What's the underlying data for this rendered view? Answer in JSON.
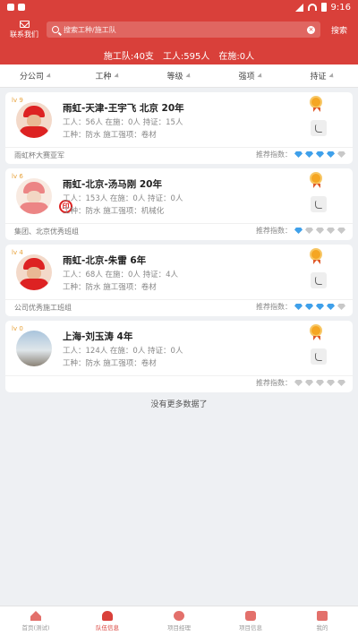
{
  "status": {
    "time": "9:16"
  },
  "header": {
    "contact_label": "联系我们",
    "search_placeholder": "搜索工种/施工队",
    "search_button": "搜索"
  },
  "summary": {
    "teams": "施工队:40支",
    "workers": "工人:595人",
    "on_site": "在施:0人"
  },
  "filters": [
    "分公司",
    "工种",
    "等级",
    "强项",
    "持证"
  ],
  "teams": [
    {
      "level": "lv 9",
      "title": "雨虹-天津-王宇飞  北京 20年",
      "stats": "工人：56人  在施：0人  持证：15人",
      "trade": "工种：防水    施工强项：卷材",
      "honor": "雨虹杯大赛亚军",
      "rec_label": "推荐指数：",
      "rating": 4
    },
    {
      "level": "lv 6",
      "title": "雨虹-北京-汤马刚   20年",
      "stats": "工人：153人  在施：0人  持证：0人",
      "trade": "工种：防水    施工强项：机械化",
      "honor": "集团、北京优秀班组",
      "rec_label": "推荐指数：",
      "rating": 1
    },
    {
      "level": "lv 4",
      "title": "雨虹-北京-朱雷   6年",
      "stats": "工人：68人  在施：0人  持证：4人",
      "trade": "工种：防水    施工强项：卷材",
      "honor": "公司优秀施工班组",
      "rec_label": "推荐指数：",
      "rating": 4
    },
    {
      "level": "lv 0",
      "title": "上海-刘玉涛   4年",
      "stats": "工人：124人  在施：0人  持证：0人",
      "trade": "工种：防水    施工强项：卷材",
      "honor": "",
      "rec_label": "推荐指数：",
      "rating": 0
    }
  ],
  "no_more": "没有更多数据了",
  "tabs": [
    {
      "label": "首页(测试)",
      "icon": "home-icon"
    },
    {
      "label": "队伍信息",
      "icon": "team-icon"
    },
    {
      "label": "项目经理",
      "icon": "manager-icon"
    },
    {
      "label": "项目信息",
      "icon": "project-icon"
    },
    {
      "label": "我的",
      "icon": "mine-icon"
    }
  ],
  "colors": {
    "brand": "#d9403a",
    "diamond_on": "#3fa0ea",
    "diamond_off": "#c8c8c8"
  }
}
